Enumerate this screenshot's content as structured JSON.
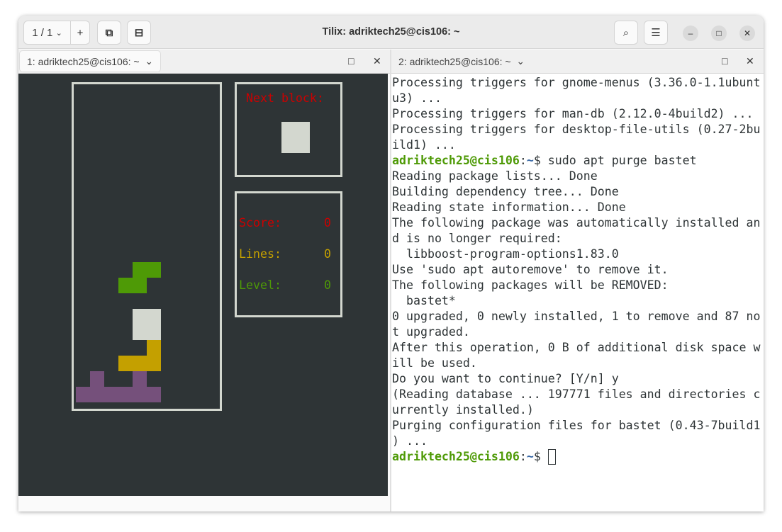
{
  "window": {
    "title": "Tilix: adriktech25@cis106: ~",
    "session_counter": "1 / 1"
  },
  "panes": [
    {
      "tab_label": "1: adriktech25@cis106: ~"
    },
    {
      "tab_label": "2: adriktech25@cis106: ~"
    }
  ],
  "game": {
    "next_label": "Next block:",
    "score_label": "Score:",
    "score": "0",
    "lines_label": "Lines:",
    "lines": "0",
    "level_label": "Level:",
    "level": "0",
    "colors": {
      "green": "#4e9a06",
      "white": "#d3d7cf",
      "yellow": "#c4a000",
      "purple": "#75507b",
      "red": "#cc0000"
    }
  },
  "terminal": {
    "prompt_user": "adriktech25@cis106",
    "prompt_path": "~",
    "lines_before": [
      "Processing triggers for gnome-menus (3.36.0-1.1ubunt",
      "u3) ...",
      "Processing triggers for man-db (2.12.0-4build2) ...",
      "Processing triggers for desktop-file-utils (0.27-2bu",
      "ild1) ..."
    ],
    "command": "$ sudo apt purge bastet",
    "lines_after": [
      "Reading package lists... Done",
      "Building dependency tree... Done",
      "Reading state information... Done",
      "The following package was automatically installed an",
      "d is no longer required:",
      "  libboost-program-options1.83.0",
      "Use 'sudo apt autoremove' to remove it.",
      "The following packages will be REMOVED:",
      "  bastet*",
      "0 upgraded, 0 newly installed, 1 to remove and 87 no",
      "t upgraded.",
      "After this operation, 0 B of additional disk space w",
      "ill be used.",
      "Do you want to continue? [Y/n] y",
      "(Reading database ... 197771 files and directories c",
      "urrently installed.)",
      "Purging configuration files for bastet (0.43-7build1",
      ") ..."
    ],
    "final_prompt": "$ "
  }
}
